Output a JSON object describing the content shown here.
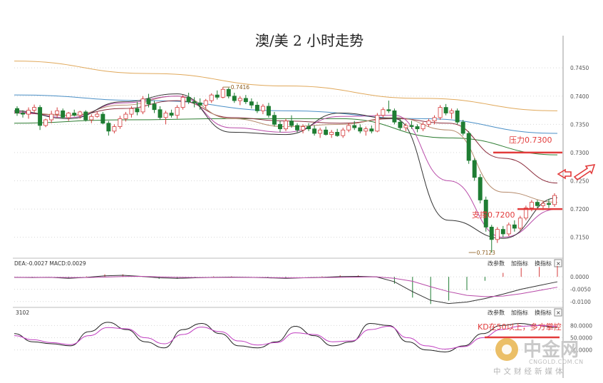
{
  "title": "澳/美 2 小时走势",
  "chart_data": [
    {
      "type": "candlestick",
      "title": "澳/美 2 小时走势",
      "y_ticks": [
        "0.7450",
        "0.7400",
        "0.7350",
        "0.7300",
        "0.7250",
        "0.7200",
        "0.7150"
      ],
      "ylim": [
        0.7118,
        0.7478
      ],
      "grid": true,
      "candles": [
        [
          0.7378,
          0.7382,
          0.7365,
          0.737
        ],
        [
          0.737,
          0.7375,
          0.7362,
          0.7368
        ],
        [
          0.7368,
          0.738,
          0.736,
          0.7375
        ],
        [
          0.7375,
          0.7385,
          0.737,
          0.738
        ],
        [
          0.738,
          0.7384,
          0.734,
          0.7348
        ],
        [
          0.7348,
          0.736,
          0.7345,
          0.7358
        ],
        [
          0.7358,
          0.7374,
          0.7352,
          0.7368
        ],
        [
          0.7368,
          0.738,
          0.7362,
          0.7374
        ],
        [
          0.7374,
          0.7378,
          0.736,
          0.7362
        ],
        [
          0.7362,
          0.7372,
          0.7356,
          0.737
        ],
        [
          0.737,
          0.7376,
          0.7364,
          0.7366
        ],
        [
          0.7366,
          0.7374,
          0.736,
          0.7372
        ],
        [
          0.7372,
          0.7375,
          0.7355,
          0.7358
        ],
        [
          0.7358,
          0.7368,
          0.7352,
          0.7364
        ],
        [
          0.7364,
          0.7372,
          0.7362,
          0.7368
        ],
        [
          0.7368,
          0.7372,
          0.735,
          0.7352
        ],
        [
          0.7352,
          0.7356,
          0.733,
          0.7338
        ],
        [
          0.7338,
          0.735,
          0.7334,
          0.7346
        ],
        [
          0.7346,
          0.7365,
          0.7342,
          0.736
        ],
        [
          0.736,
          0.7372,
          0.7355,
          0.7368
        ],
        [
          0.7368,
          0.7382,
          0.7362,
          0.7378
        ],
        [
          0.7378,
          0.739,
          0.7366,
          0.7372
        ],
        [
          0.7372,
          0.74,
          0.7368,
          0.7395
        ],
        [
          0.7395,
          0.7404,
          0.738,
          0.7386
        ],
        [
          0.7386,
          0.7392,
          0.737,
          0.7376
        ],
        [
          0.7376,
          0.7382,
          0.7358,
          0.7362
        ],
        [
          0.7362,
          0.7374,
          0.735,
          0.737
        ],
        [
          0.737,
          0.7376,
          0.7362,
          0.7366
        ],
        [
          0.7366,
          0.7384,
          0.736,
          0.738
        ],
        [
          0.738,
          0.7402,
          0.7376,
          0.7398
        ],
        [
          0.7398,
          0.7406,
          0.7386,
          0.739
        ],
        [
          0.739,
          0.7398,
          0.738,
          0.7388
        ],
        [
          0.7388,
          0.7396,
          0.7376,
          0.7384
        ],
        [
          0.7384,
          0.7395,
          0.7378,
          0.7392
        ],
        [
          0.7392,
          0.7405,
          0.7388,
          0.7402
        ],
        [
          0.7402,
          0.741,
          0.7394,
          0.7398
        ],
        [
          0.7398,
          0.7416,
          0.7396,
          0.7412
        ],
        [
          0.7412,
          0.7415,
          0.7396,
          0.74
        ],
        [
          0.74,
          0.7406,
          0.7388,
          0.7392
        ],
        [
          0.7392,
          0.74,
          0.7384,
          0.7396
        ],
        [
          0.7396,
          0.7402,
          0.7386,
          0.739
        ],
        [
          0.739,
          0.7396,
          0.7378,
          0.7384
        ],
        [
          0.7384,
          0.739,
          0.737,
          0.7374
        ],
        [
          0.7374,
          0.7386,
          0.7368,
          0.7382
        ],
        [
          0.7382,
          0.7388,
          0.7362,
          0.7366
        ],
        [
          0.7366,
          0.7372,
          0.7346,
          0.735
        ],
        [
          0.735,
          0.7356,
          0.7336,
          0.7342
        ],
        [
          0.7342,
          0.736,
          0.7338,
          0.7356
        ],
        [
          0.7356,
          0.7366,
          0.7344,
          0.7348
        ],
        [
          0.7348,
          0.7352,
          0.7336,
          0.734
        ],
        [
          0.734,
          0.735,
          0.7334,
          0.7346
        ],
        [
          0.7346,
          0.7352,
          0.7338,
          0.7342
        ],
        [
          0.7342,
          0.7348,
          0.733,
          0.7334
        ],
        [
          0.7334,
          0.7344,
          0.7326,
          0.734
        ],
        [
          0.734,
          0.7346,
          0.733,
          0.7332
        ],
        [
          0.7332,
          0.734,
          0.7326,
          0.7336
        ],
        [
          0.7336,
          0.7342,
          0.7328,
          0.733
        ],
        [
          0.733,
          0.7344,
          0.7326,
          0.734
        ],
        [
          0.734,
          0.7352,
          0.7336,
          0.7348
        ],
        [
          0.7348,
          0.7356,
          0.734,
          0.7344
        ],
        [
          0.7344,
          0.735,
          0.7334,
          0.7338
        ],
        [
          0.7338,
          0.7346,
          0.733,
          0.7342
        ],
        [
          0.7342,
          0.7348,
          0.7334,
          0.7338
        ],
        [
          0.7338,
          0.737,
          0.7336,
          0.7366
        ],
        [
          0.7366,
          0.738,
          0.7362,
          0.7376
        ],
        [
          0.7376,
          0.7392,
          0.737,
          0.7374
        ],
        [
          0.7374,
          0.7378,
          0.735,
          0.7354
        ],
        [
          0.7354,
          0.736,
          0.734,
          0.7344
        ],
        [
          0.7344,
          0.7352,
          0.7338,
          0.7348
        ],
        [
          0.7348,
          0.7356,
          0.7342,
          0.7346
        ],
        [
          0.7346,
          0.735,
          0.7336,
          0.7342
        ],
        [
          0.7342,
          0.7354,
          0.7338,
          0.735
        ],
        [
          0.735,
          0.736,
          0.7346,
          0.7356
        ],
        [
          0.7356,
          0.7366,
          0.735,
          0.7362
        ],
        [
          0.7362,
          0.7384,
          0.7358,
          0.738
        ],
        [
          0.738,
          0.7386,
          0.7366,
          0.737
        ],
        [
          0.737,
          0.7378,
          0.736,
          0.7374
        ],
        [
          0.7374,
          0.7378,
          0.735,
          0.7354
        ],
        [
          0.7354,
          0.7358,
          0.733,
          0.7334
        ],
        [
          0.7334,
          0.7338,
          0.728,
          0.7286
        ],
        [
          0.7286,
          0.729,
          0.725,
          0.7256
        ],
        [
          0.7256,
          0.7262,
          0.721,
          0.7216
        ],
        [
          0.7216,
          0.7222,
          0.716,
          0.7168
        ],
        [
          0.7168,
          0.7172,
          0.7123,
          0.7146
        ],
        [
          0.7146,
          0.7168,
          0.714,
          0.7164
        ],
        [
          0.7164,
          0.717,
          0.715,
          0.7156
        ],
        [
          0.7156,
          0.7176,
          0.7152,
          0.7172
        ],
        [
          0.7172,
          0.718,
          0.716,
          0.7166
        ],
        [
          0.7166,
          0.7188,
          0.7162,
          0.7184
        ],
        [
          0.7184,
          0.7206,
          0.718,
          0.7202
        ],
        [
          0.7202,
          0.7216,
          0.7196,
          0.7212
        ],
        [
          0.7212,
          0.7216,
          0.72,
          0.7206
        ],
        [
          0.7206,
          0.7214,
          0.7198,
          0.721
        ],
        [
          0.721,
          0.7218,
          0.7202,
          0.7208
        ],
        [
          0.7208,
          0.7228,
          0.7204,
          0.7224
        ]
      ],
      "series": [
        {
          "color": "#e0a85a",
          "values": [
            0.7462,
            0.744,
            0.7418,
            0.7396,
            0.7374
          ]
        },
        {
          "color": "#4a8fc6",
          "values": [
            0.7402,
            0.7392,
            0.7374,
            0.736,
            0.7334
          ]
        },
        {
          "color": "#2e7d32",
          "values": [
            0.7352,
            0.7358,
            0.736,
            0.736,
            0.7326,
            0.7296
          ]
        },
        {
          "color": "#8b2c3c",
          "values": [
            0.737,
            0.7366,
            0.7378,
            0.7392,
            0.7362,
            0.7356,
            0.7352,
            0.736,
            0.7352,
            0.729,
            0.7246
          ]
        },
        {
          "color": "#b58a6b",
          "values": [
            0.7372,
            0.7366,
            0.7384,
            0.74,
            0.736,
            0.7346,
            0.735,
            0.7362,
            0.734,
            0.723,
            0.7212
          ]
        },
        {
          "color": "#b84aa8",
          "values": [
            0.7372,
            0.7362,
            0.7388,
            0.74,
            0.7344,
            0.7336,
            0.7364,
            0.7366,
            0.725,
            0.715,
            0.72
          ]
        },
        {
          "color": "#333333",
          "values": [
            0.7374,
            0.736,
            0.739,
            0.7404,
            0.7336,
            0.7332,
            0.737,
            0.736,
            0.718,
            0.7148,
            0.722
          ]
        }
      ],
      "annotations": [
        {
          "text": "0.7416",
          "x_index": 36,
          "y": 0.7416
        },
        {
          "text": "0.7123",
          "x_index": 79,
          "y": 0.7123
        }
      ],
      "levels": [
        {
          "label": "压力0.7300",
          "y": 0.73,
          "color": "#e23b3b"
        },
        {
          "label": "支撑0.7200",
          "y": 0.72,
          "color": "#e23b3b"
        }
      ]
    },
    {
      "type": "bar",
      "title": "MACD",
      "header": "DEA:-0.0027 MACD:0.0029",
      "y_ticks": [
        "0.0000",
        "-0.0050",
        "-0.0100"
      ],
      "ylim": [
        -0.0115,
        0.0035
      ],
      "dif": [
        -0.0002,
        -0.0003,
        -0.0002,
        -0.0006,
        -0.0002,
        0.0004,
        0.0006,
        0.0002,
        -0.0004,
        -0.0006,
        -0.0004,
        -0.0002,
        -0.0001,
        -0.0002,
        -0.0004,
        -0.0006,
        -0.0004,
        -0.0002,
        0.0001,
        0.0002,
        0.0,
        -0.002,
        -0.006,
        -0.0095,
        -0.0108,
        -0.0102,
        -0.0088,
        -0.007,
        -0.005,
        -0.0035,
        -0.002
      ],
      "dea": [
        -0.0002,
        -0.0002,
        -0.0002,
        -0.0003,
        -0.0003,
        -0.0001,
        0.0001,
        0.0002,
        0.0,
        -0.0002,
        -0.0003,
        -0.0003,
        -0.0002,
        -0.0002,
        -0.0003,
        -0.0004,
        -0.0004,
        -0.0003,
        -0.0002,
        -0.0001,
        0.0,
        -0.0006,
        -0.0018,
        -0.004,
        -0.006,
        -0.0075,
        -0.008,
        -0.0078,
        -0.0068,
        -0.0055,
        -0.0042
      ]
    },
    {
      "type": "line",
      "title": "KD",
      "header": "3102",
      "y_ticks": [
        "80.0000",
        "50.0000",
        "20.0000"
      ],
      "ylim": [
        0,
        100
      ],
      "k": [
        60,
        40,
        35,
        30,
        65,
        88,
        70,
        40,
        25,
        70,
        85,
        60,
        30,
        25,
        40,
        78,
        55,
        30,
        40,
        85,
        80,
        40,
        20,
        15,
        30,
        60,
        80,
        85,
        80,
        75
      ],
      "d": [
        55,
        45,
        38,
        33,
        55,
        75,
        72,
        50,
        35,
        58,
        76,
        65,
        42,
        32,
        38,
        62,
        58,
        40,
        42,
        70,
        78,
        50,
        30,
        22,
        28,
        50,
        70,
        78,
        80,
        78
      ],
      "annotation": "KD在50以上，多方掌控"
    }
  ],
  "toolbar": {
    "btn1": "改参数",
    "btn2": "加指标",
    "btn3": "换指标",
    "close": "×"
  },
  "logo": {
    "name": "中金网",
    "url": "CNGOLD.COM.CN",
    "tagline": "中文财经新媒体"
  },
  "colors": {
    "up": "#d43c3c",
    "down": "#1f7d33",
    "level": "#e23b3b",
    "arrow": "#e23b3b"
  }
}
